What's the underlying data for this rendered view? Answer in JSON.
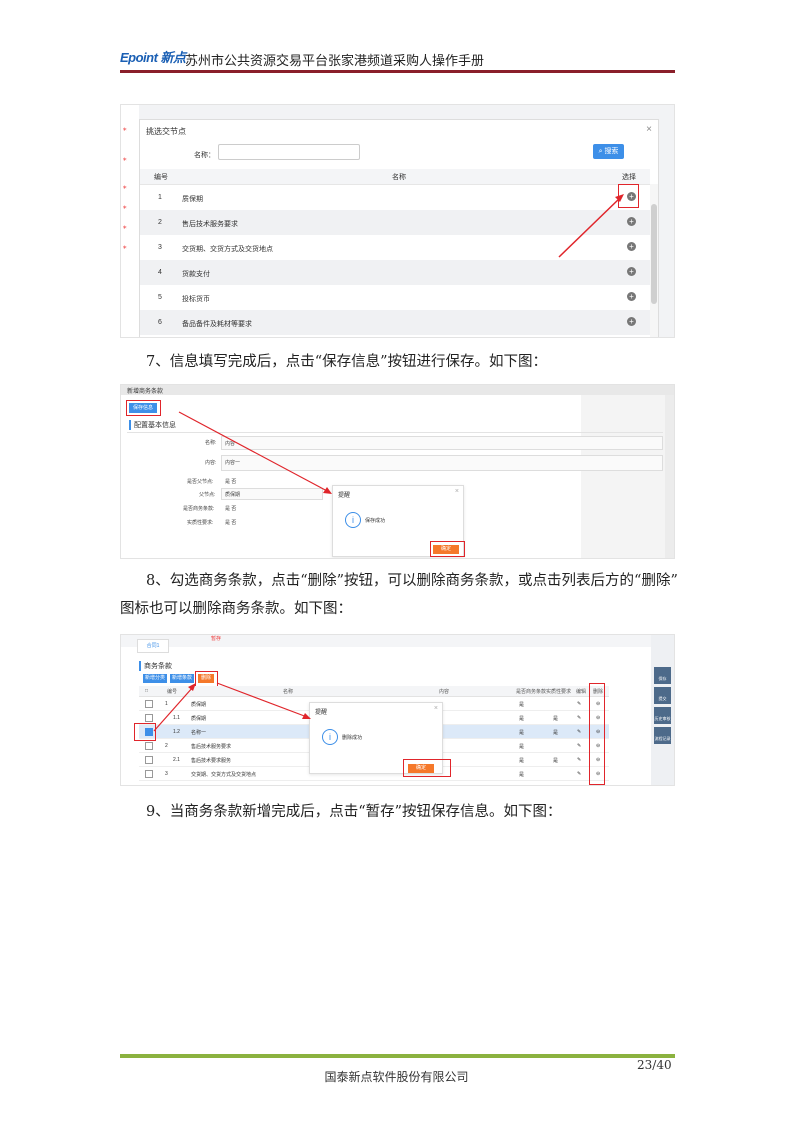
{
  "header": {
    "logo": "Epoint 新点",
    "title": "苏州市公共资源交易平台张家港频道采购人操作手册"
  },
  "shot1": {
    "dialog_title": "挑选交节点",
    "name_label": "名称：",
    "search_button": "搜索",
    "columns": {
      "num": "编号",
      "name": "名称",
      "select": "选择"
    },
    "rows": [
      {
        "num": "1",
        "name": "质保期"
      },
      {
        "num": "2",
        "name": "售后技术服务要求"
      },
      {
        "num": "3",
        "name": "交货期、交货方式及交货地点"
      },
      {
        "num": "4",
        "name": "货款支付"
      },
      {
        "num": "5",
        "name": "投标货币"
      },
      {
        "num": "6",
        "name": "备品备件及耗材等要求"
      }
    ]
  },
  "step7": "7、信息填写完成后，点击“保存信息”按钮进行保存。如下图：",
  "shot2": {
    "window_title": "新增商务条款",
    "save_button": "保存信息",
    "section_title": "配置基本信息",
    "fields": [
      {
        "label": "名称:",
        "value": "内容"
      },
      {
        "label": "内容:",
        "value": "内容一"
      },
      {
        "label": "是否父节点:",
        "value": "是  否"
      },
      {
        "label": "父节点:",
        "value": "质保期"
      },
      {
        "label": "是否商务条款:",
        "value": "是  否"
      },
      {
        "label": "实质性要求:",
        "value": "是  否"
      }
    ],
    "dialog_title": "提醒",
    "dialog_msg": "保存成功",
    "ok_button": "确定"
  },
  "step8_line1": "8、勾选商务条款，点击“删除”按钮，可以删除商务条款，或点击列表后方的“删除”",
  "step8_line2": "图标也可以删除商务条款。如下图：",
  "shot3": {
    "tab": "合同1",
    "tag": "暂存",
    "section_title": "商务条款",
    "btn_add_category": "新增分类",
    "btn_add_clause": "新增条款",
    "btn_delete": "删除",
    "columns": [
      "编号",
      "名称",
      "内容",
      "是否商务条款",
      "实质性要求",
      "编辑",
      "删除"
    ],
    "rows": [
      {
        "num": "1",
        "name": "质保期",
        "biz": "是",
        "req": ""
      },
      {
        "num": "1.1",
        "name": "质保期",
        "biz": "是",
        "req": "是"
      },
      {
        "num": "1.2",
        "name": "名称一",
        "biz": "是",
        "req": "是"
      },
      {
        "num": "2",
        "name": "售后技术服务要求",
        "biz": "是",
        "req": ""
      },
      {
        "num": "2.1",
        "name": "售后技术要求服务",
        "biz": "是",
        "req": "是"
      },
      {
        "num": "3",
        "name": "交货期、交货方式及交货地点",
        "biz": "是",
        "req": ""
      }
    ],
    "side": [
      "保存",
      "提交",
      "历史审核",
      "流程记录"
    ],
    "dialog_title": "提醒",
    "dialog_msg": "删除成功",
    "ok_button": "确定"
  },
  "step9": "9、当商务条款新增完成后，点击“暂存”按钮保存信息。如下图：",
  "footer": {
    "page": "23/40",
    "company": "国泰新点软件股份有限公司"
  }
}
